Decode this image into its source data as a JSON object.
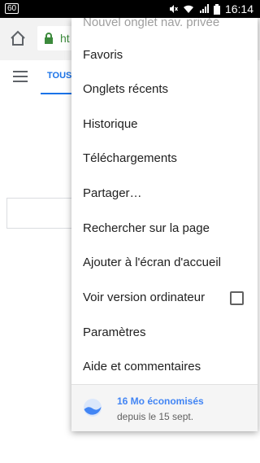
{
  "status_bar": {
    "left_badge": "60",
    "time": "16:14"
  },
  "toolbar": {
    "url_text": "ht"
  },
  "page": {
    "tab_label": "TOUS"
  },
  "menu": {
    "partial_item": "Nouvel onglet nav. privée",
    "items": [
      {
        "label": "Favoris"
      },
      {
        "label": "Onglets récents"
      },
      {
        "label": "Historique"
      },
      {
        "label": "Téléchargements"
      },
      {
        "label": "Partager…"
      },
      {
        "label": "Rechercher sur la page"
      },
      {
        "label": "Ajouter à l'écran d'accueil"
      },
      {
        "label": "Voir version ordinateur",
        "checkbox_checked": false
      },
      {
        "label": "Paramètres"
      },
      {
        "label": "Aide et commentaires"
      }
    ],
    "savings": {
      "title": "16 Mo économisés",
      "subtitle": "depuis le 15 sept."
    }
  },
  "colors": {
    "accent": "#4285f4",
    "tab_accent": "#1a73e8",
    "lock_green": "#3c8a3c"
  }
}
